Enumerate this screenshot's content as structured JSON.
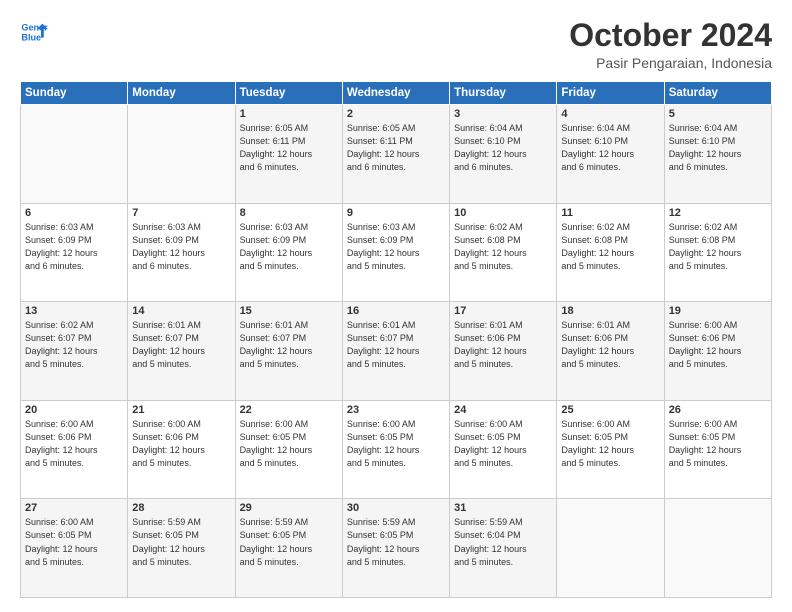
{
  "logo": {
    "line1": "General",
    "line2": "Blue"
  },
  "header": {
    "month": "October 2024",
    "location": "Pasir Pengaraian, Indonesia"
  },
  "weekdays": [
    "Sunday",
    "Monday",
    "Tuesday",
    "Wednesday",
    "Thursday",
    "Friday",
    "Saturday"
  ],
  "weeks": [
    [
      {
        "day": "",
        "info": ""
      },
      {
        "day": "",
        "info": ""
      },
      {
        "day": "1",
        "info": "Sunrise: 6:05 AM\nSunset: 6:11 PM\nDaylight: 12 hours\nand 6 minutes."
      },
      {
        "day": "2",
        "info": "Sunrise: 6:05 AM\nSunset: 6:11 PM\nDaylight: 12 hours\nand 6 minutes."
      },
      {
        "day": "3",
        "info": "Sunrise: 6:04 AM\nSunset: 6:10 PM\nDaylight: 12 hours\nand 6 minutes."
      },
      {
        "day": "4",
        "info": "Sunrise: 6:04 AM\nSunset: 6:10 PM\nDaylight: 12 hours\nand 6 minutes."
      },
      {
        "day": "5",
        "info": "Sunrise: 6:04 AM\nSunset: 6:10 PM\nDaylight: 12 hours\nand 6 minutes."
      }
    ],
    [
      {
        "day": "6",
        "info": "Sunrise: 6:03 AM\nSunset: 6:09 PM\nDaylight: 12 hours\nand 6 minutes."
      },
      {
        "day": "7",
        "info": "Sunrise: 6:03 AM\nSunset: 6:09 PM\nDaylight: 12 hours\nand 6 minutes."
      },
      {
        "day": "8",
        "info": "Sunrise: 6:03 AM\nSunset: 6:09 PM\nDaylight: 12 hours\nand 5 minutes."
      },
      {
        "day": "9",
        "info": "Sunrise: 6:03 AM\nSunset: 6:09 PM\nDaylight: 12 hours\nand 5 minutes."
      },
      {
        "day": "10",
        "info": "Sunrise: 6:02 AM\nSunset: 6:08 PM\nDaylight: 12 hours\nand 5 minutes."
      },
      {
        "day": "11",
        "info": "Sunrise: 6:02 AM\nSunset: 6:08 PM\nDaylight: 12 hours\nand 5 minutes."
      },
      {
        "day": "12",
        "info": "Sunrise: 6:02 AM\nSunset: 6:08 PM\nDaylight: 12 hours\nand 5 minutes."
      }
    ],
    [
      {
        "day": "13",
        "info": "Sunrise: 6:02 AM\nSunset: 6:07 PM\nDaylight: 12 hours\nand 5 minutes."
      },
      {
        "day": "14",
        "info": "Sunrise: 6:01 AM\nSunset: 6:07 PM\nDaylight: 12 hours\nand 5 minutes."
      },
      {
        "day": "15",
        "info": "Sunrise: 6:01 AM\nSunset: 6:07 PM\nDaylight: 12 hours\nand 5 minutes."
      },
      {
        "day": "16",
        "info": "Sunrise: 6:01 AM\nSunset: 6:07 PM\nDaylight: 12 hours\nand 5 minutes."
      },
      {
        "day": "17",
        "info": "Sunrise: 6:01 AM\nSunset: 6:06 PM\nDaylight: 12 hours\nand 5 minutes."
      },
      {
        "day": "18",
        "info": "Sunrise: 6:01 AM\nSunset: 6:06 PM\nDaylight: 12 hours\nand 5 minutes."
      },
      {
        "day": "19",
        "info": "Sunrise: 6:00 AM\nSunset: 6:06 PM\nDaylight: 12 hours\nand 5 minutes."
      }
    ],
    [
      {
        "day": "20",
        "info": "Sunrise: 6:00 AM\nSunset: 6:06 PM\nDaylight: 12 hours\nand 5 minutes."
      },
      {
        "day": "21",
        "info": "Sunrise: 6:00 AM\nSunset: 6:06 PM\nDaylight: 12 hours\nand 5 minutes."
      },
      {
        "day": "22",
        "info": "Sunrise: 6:00 AM\nSunset: 6:05 PM\nDaylight: 12 hours\nand 5 minutes."
      },
      {
        "day": "23",
        "info": "Sunrise: 6:00 AM\nSunset: 6:05 PM\nDaylight: 12 hours\nand 5 minutes."
      },
      {
        "day": "24",
        "info": "Sunrise: 6:00 AM\nSunset: 6:05 PM\nDaylight: 12 hours\nand 5 minutes."
      },
      {
        "day": "25",
        "info": "Sunrise: 6:00 AM\nSunset: 6:05 PM\nDaylight: 12 hours\nand 5 minutes."
      },
      {
        "day": "26",
        "info": "Sunrise: 6:00 AM\nSunset: 6:05 PM\nDaylight: 12 hours\nand 5 minutes."
      }
    ],
    [
      {
        "day": "27",
        "info": "Sunrise: 6:00 AM\nSunset: 6:05 PM\nDaylight: 12 hours\nand 5 minutes."
      },
      {
        "day": "28",
        "info": "Sunrise: 5:59 AM\nSunset: 6:05 PM\nDaylight: 12 hours\nand 5 minutes."
      },
      {
        "day": "29",
        "info": "Sunrise: 5:59 AM\nSunset: 6:05 PM\nDaylight: 12 hours\nand 5 minutes."
      },
      {
        "day": "30",
        "info": "Sunrise: 5:59 AM\nSunset: 6:05 PM\nDaylight: 12 hours\nand 5 minutes."
      },
      {
        "day": "31",
        "info": "Sunrise: 5:59 AM\nSunset: 6:04 PM\nDaylight: 12 hours\nand 5 minutes."
      },
      {
        "day": "",
        "info": ""
      },
      {
        "day": "",
        "info": ""
      }
    ]
  ]
}
